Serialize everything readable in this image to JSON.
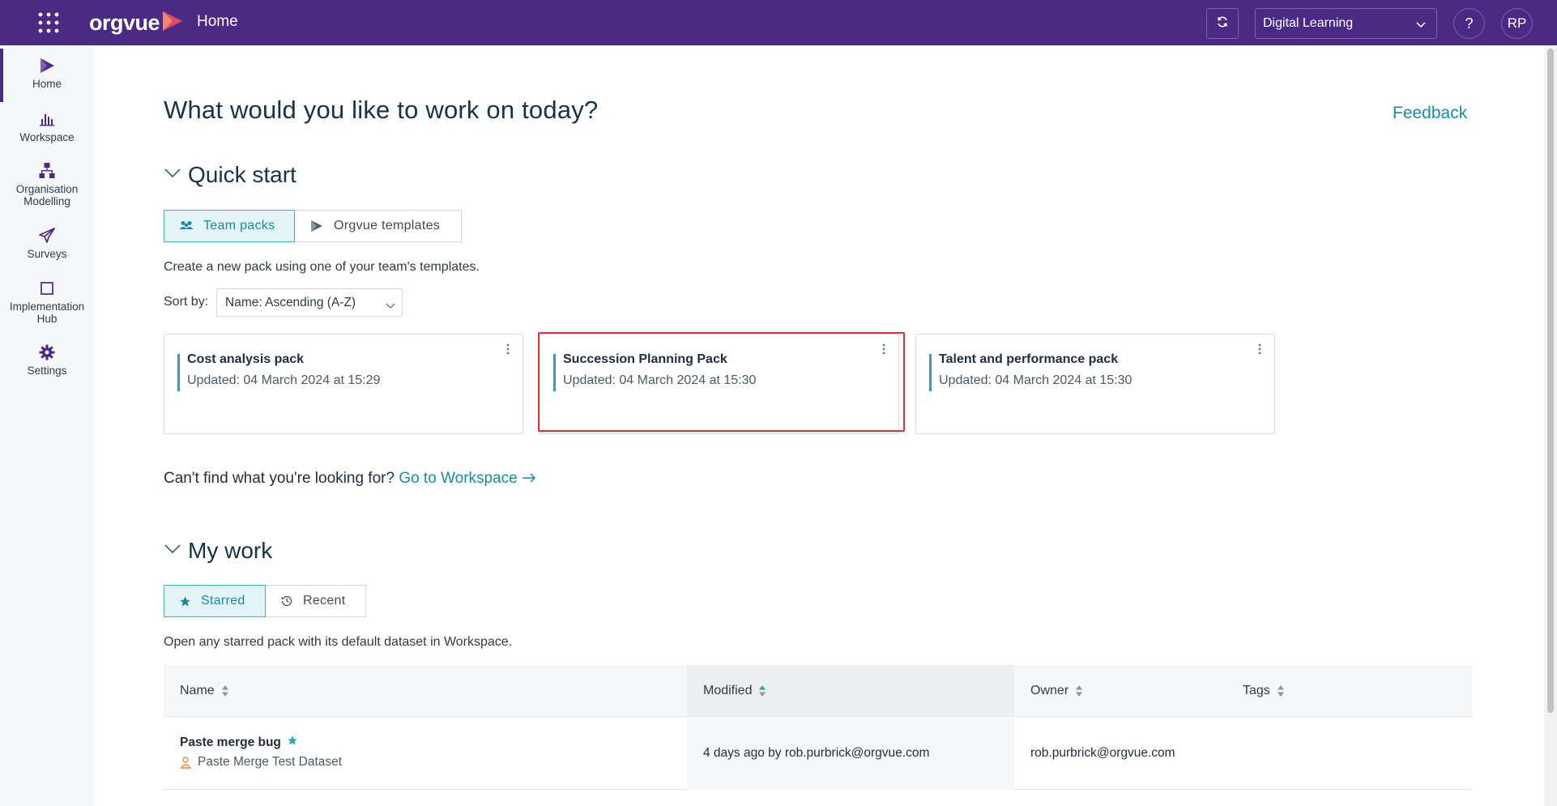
{
  "header": {
    "brand": "orgvue",
    "title": "Home",
    "org_select": "Digital Learning",
    "help": "?",
    "avatar": "RP",
    "icons": {
      "apps": "grid-icon",
      "sync": "sync-icon"
    },
    "colors": {
      "bar": "#4b2a85",
      "accent": "#1a8aa0",
      "brand_mark": "#e84a5f"
    }
  },
  "sidebar": {
    "items": [
      {
        "label": "Home",
        "icon": "home-icon",
        "active": true
      },
      {
        "label": "Workspace",
        "icon": "bar-chart-icon"
      },
      {
        "label": "Organisation Modelling",
        "icon": "org-chart-icon"
      },
      {
        "label": "Surveys",
        "icon": "paper-plane-icon"
      },
      {
        "label": "Implementation Hub",
        "icon": "square-icon"
      },
      {
        "label": "Settings",
        "icon": "gear-icon"
      }
    ]
  },
  "main": {
    "title": "What would you like to work on today?",
    "feedback": "Feedback",
    "quick_start": {
      "heading": "Quick start",
      "tabs": [
        {
          "label": "Team packs",
          "active": true
        },
        {
          "label": "Orgvue templates",
          "active": false
        }
      ],
      "description": "Create a new pack using one of your team's templates.",
      "sort_label": "Sort by:",
      "sort_value": "Name: Ascending (A-Z)",
      "cards": [
        {
          "title": "Cost analysis pack",
          "updated": "Updated: 04 March 2024 at 15:29"
        },
        {
          "title": "Succession Planning Pack",
          "updated": "Updated: 04 March 2024 at 15:30"
        },
        {
          "title": "Talent and performance pack",
          "updated": "Updated: 04 March 2024 at 15:30"
        }
      ],
      "cant_find": "Can't find what you're looking for?",
      "go_to_workspace": "Go to Workspace"
    },
    "my_work": {
      "heading": "My work",
      "tabs": [
        {
          "label": "Starred",
          "active": true
        },
        {
          "label": "Recent",
          "active": false
        }
      ],
      "description": "Open any starred pack with its default dataset in Workspace.",
      "columns": [
        "Name",
        "Modified",
        "Owner",
        "Tags"
      ],
      "rows": [
        {
          "name": "Paste merge bug",
          "dataset": "Paste Merge Test Dataset",
          "modified": "4 days ago by rob.purbrick@orgvue.com",
          "owner": "rob.purbrick@orgvue.com",
          "tags": ""
        }
      ]
    }
  }
}
